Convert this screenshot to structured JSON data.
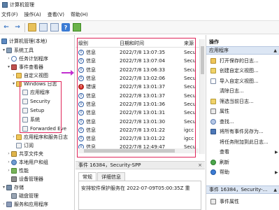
{
  "window": {
    "title": "计算机管理"
  },
  "menu": [
    "文件(F)",
    "操作(A)",
    "查看(V)",
    "帮助(H)"
  ],
  "toolbar": {
    "buttons": [
      "back-icon",
      "forward-icon",
      "folder-up-icon",
      "show-hide-tree-icon",
      "properties-icon",
      "help-icon",
      "export-list-icon"
    ]
  },
  "tree": {
    "root": "计算机管理(本地)",
    "system_tools": "系统工具",
    "task_scheduler": "任务计划程序",
    "event_viewer": "事件查看器",
    "custom_views": "自定义视图",
    "windows_logs": "Windows 日志",
    "logs": [
      "应用程序",
      "Security",
      "Setup",
      "系统",
      "Forwarded Eve"
    ],
    "apps_services_logs": "应用程序和服务日志",
    "subscriptions": "订阅",
    "shared_folders": "共享文件夹",
    "local_users": "本地用户和组",
    "performance": "性能",
    "device_manager": "设备管理器",
    "storage": "存储",
    "disk_management": "磁盘管理",
    "services_apps": "服务和应用程序"
  },
  "grid": {
    "headers": {
      "level": "级别",
      "date": "日期和时间",
      "source": "来源"
    },
    "rows": [
      {
        "level": "信息",
        "type": "info",
        "datetime": "2022/7/8 13:07:35",
        "source": "Secu"
      },
      {
        "level": "信息",
        "type": "info",
        "datetime": "2022/7/8 13:07:04",
        "source": "Secu"
      },
      {
        "level": "信息",
        "type": "info",
        "datetime": "2022/7/8 13:06:33",
        "source": "Secu"
      },
      {
        "level": "信息",
        "type": "info",
        "datetime": "2022/7/8 13:02:06",
        "source": "Secu"
      },
      {
        "level": "错误",
        "type": "error",
        "datetime": "2022/7/8 13:01:37",
        "source": "Secu"
      },
      {
        "level": "信息",
        "type": "info",
        "datetime": "2022/7/8 13:01:37",
        "source": "Secu"
      },
      {
        "level": "信息",
        "type": "info",
        "datetime": "2022/7/8 13:01:36",
        "source": "Secu"
      },
      {
        "level": "信息",
        "type": "info",
        "datetime": "2022/7/8 13:01:31",
        "source": "Secu"
      },
      {
        "level": "信息",
        "type": "info",
        "datetime": "2022/7/8 13:01:30",
        "source": "Secu"
      },
      {
        "level": "信息",
        "type": "info",
        "datetime": "2022/7/8 13:01:22",
        "source": "igcc"
      },
      {
        "level": "信息",
        "type": "info",
        "datetime": "2022/7/8 13:01:22",
        "source": "igcc"
      },
      {
        "level": "信息",
        "type": "info",
        "datetime": "2022/7/8 12:49:47",
        "source": "Secu"
      }
    ]
  },
  "detail": {
    "header": "事件 16384，Security-SPP",
    "close": "×",
    "tabs": [
      "常规",
      "详细信息"
    ],
    "text": "安排软件保护服务在 2022-07-09T05:00:35Z 重"
  },
  "actions": {
    "title": "操作",
    "section1": "应用程序",
    "items": [
      {
        "label": "打开保存的日志...",
        "icon": "open-log-icon"
      },
      {
        "label": "创建自定义视图...",
        "icon": "filter-icon"
      },
      {
        "label": "导入自定义视图...",
        "icon": "import-view-icon"
      },
      {
        "label": "清除日志...",
        "icon": ""
      },
      {
        "label": "筛选当前日志...",
        "icon": "filter-icon"
      },
      {
        "label": "属性",
        "icon": "properties-icon"
      },
      {
        "label": "查找...",
        "icon": "find-icon"
      },
      {
        "label": "将所有事件另存为...",
        "icon": "save-icon"
      },
      {
        "label": "将任务附加到此日志...",
        "icon": ""
      },
      {
        "label": "查看",
        "icon": "",
        "submenu": true
      },
      {
        "label": "刷新",
        "icon": "refresh-icon"
      },
      {
        "label": "帮助",
        "icon": "help-icon",
        "submenu": true
      }
    ],
    "section2": "事件 16384，Security-...",
    "section2_items": [
      {
        "label": "事件属性",
        "icon": "event-properties-icon"
      }
    ]
  },
  "colors": {
    "highlight": "#e0265a",
    "pointer": "#c22fd0",
    "error": "#d8312a",
    "info": "#2f5fa8"
  }
}
